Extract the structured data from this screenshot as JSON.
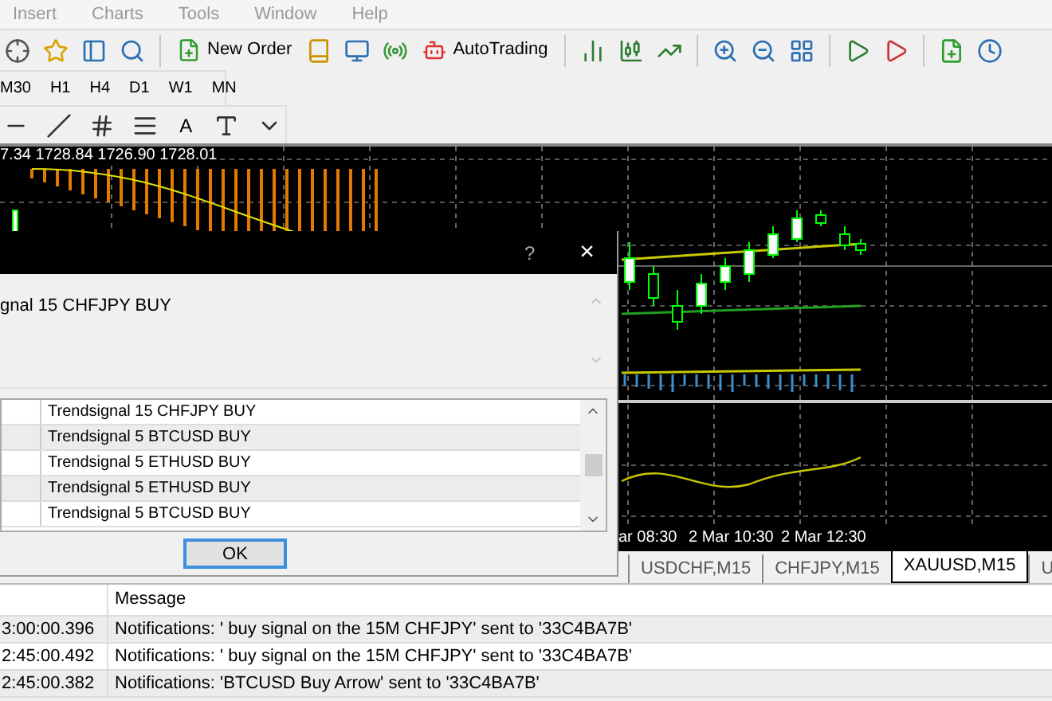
{
  "menu": [
    "Insert",
    "Charts",
    "Tools",
    "Window",
    "Help"
  ],
  "toolbar": {
    "new_order": "New Order",
    "autotrading": "AutoTrading"
  },
  "timeframes": [
    "M30",
    "H1",
    "H4",
    "D1",
    "W1",
    "MN"
  ],
  "drawing_toolbar": {
    "text_tool": "A"
  },
  "chart": {
    "ohlc": "7.34 1728.84 1726.90 1728.01",
    "time_labels": [
      "ar 08:30",
      "2 Mar 10:30",
      "2 Mar 12:30"
    ]
  },
  "dialog": {
    "help": "?",
    "close": "×",
    "message": "gnal 15 CHFJPY BUY",
    "list": [
      {
        "text": "Trendsignal 15 CHFJPY BUY"
      },
      {
        "text": "Trendsignal 5 BTCUSD BUY"
      },
      {
        "text": "Trendsignal 5 ETHUSD BUY"
      },
      {
        "text": "Trendsignal 5 ETHUSD BUY"
      },
      {
        "text": "Trendsignal 5 BTCUSD BUY"
      }
    ],
    "ok": "OK"
  },
  "tabs": [
    {
      "label": "USDCHF,M15",
      "selected": false
    },
    {
      "label": "CHFJPY,M15",
      "selected": false
    },
    {
      "label": "XAUUSD,M15",
      "selected": true
    },
    {
      "label": "U",
      "selected": false
    }
  ],
  "log": {
    "columns": [
      "Message"
    ],
    "rows": [
      {
        "time": "3:00:00.396",
        "message": "Notifications: ' buy signal on the 15M CHFJPY' sent to '33C4BA7B'"
      },
      {
        "time": "2:45:00.492",
        "message": "Notifications: ' buy signal on the 15M CHFJPY' sent to '33C4BA7B'"
      },
      {
        "time": "2:45:00.382",
        "message": "Notifications: 'BTCUSD Buy Arrow' sent to '33C4BA7B'"
      }
    ]
  }
}
